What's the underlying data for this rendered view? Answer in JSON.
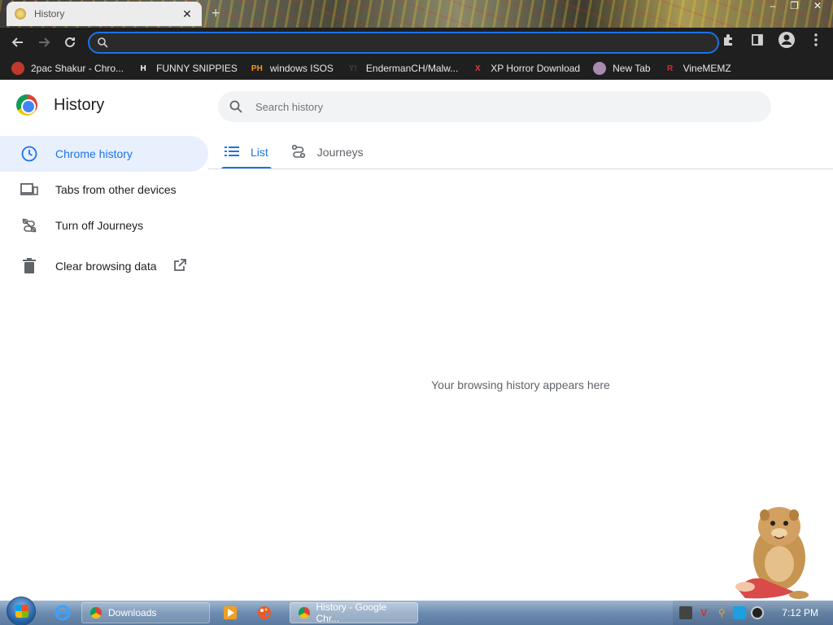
{
  "browser": {
    "tab_title": "History",
    "tab_close": "✕",
    "new_tab": "+",
    "window_controls": [
      "–",
      "❐",
      "✕"
    ],
    "address_value": "",
    "address_placeholder": ""
  },
  "bookmarks": [
    {
      "label": "2pac Shakur - Chro...",
      "icon": "2pac-favicon",
      "icon_text": "",
      "color": "#c0392b"
    },
    {
      "label": "FUNNY SNIPPIES",
      "icon": "h-favicon",
      "icon_text": "H",
      "color": "#ffffff"
    },
    {
      "label": "windows ISOS",
      "icon": "ph-favicon",
      "icon_text": "PH",
      "color": "#ff9900"
    },
    {
      "label": "EndermanCH/Malw...",
      "icon": "youpinhole-favicon",
      "icon_text": "Y!",
      "color": "#444444"
    },
    {
      "label": "XP Horror Download",
      "icon": "x-favicon",
      "icon_text": "X",
      "color": "#e53935"
    },
    {
      "label": "New Tab",
      "icon": "newtab-favicon",
      "icon_text": "",
      "color": "#a78bb0"
    },
    {
      "label": "VineMEMZ",
      "icon": "vine-favicon",
      "icon_text": "R",
      "color": "#d32f2f"
    }
  ],
  "page": {
    "title": "History",
    "search_placeholder": "Search history",
    "empty_message": "Your browsing history appears here",
    "tabs": [
      {
        "label": "List",
        "icon": "list-icon",
        "active": true
      },
      {
        "label": "Journeys",
        "icon": "journeys-icon",
        "active": false
      }
    ],
    "sidebar": [
      {
        "label": "Chrome history",
        "icon": "clock-icon",
        "active": true
      },
      {
        "label": "Tabs from other devices",
        "icon": "devices-icon",
        "active": false
      },
      {
        "label": "Turn off Journeys",
        "icon": "journeys-off-icon",
        "active": false
      },
      {
        "label": "Clear browsing data",
        "icon": "trash-icon",
        "active": false,
        "external": true
      }
    ]
  },
  "taskbar": {
    "buttons": [
      {
        "label": "Downloads",
        "icon": "chrome-icon"
      },
      {
        "label": "History - Google Chr...",
        "icon": "chrome-icon"
      }
    ],
    "clock": "7:12 PM"
  },
  "colors": {
    "accent": "#1a73e8",
    "toolbar_bg": "#1f1f1f",
    "active_nav_bg": "#e8f0fe"
  }
}
